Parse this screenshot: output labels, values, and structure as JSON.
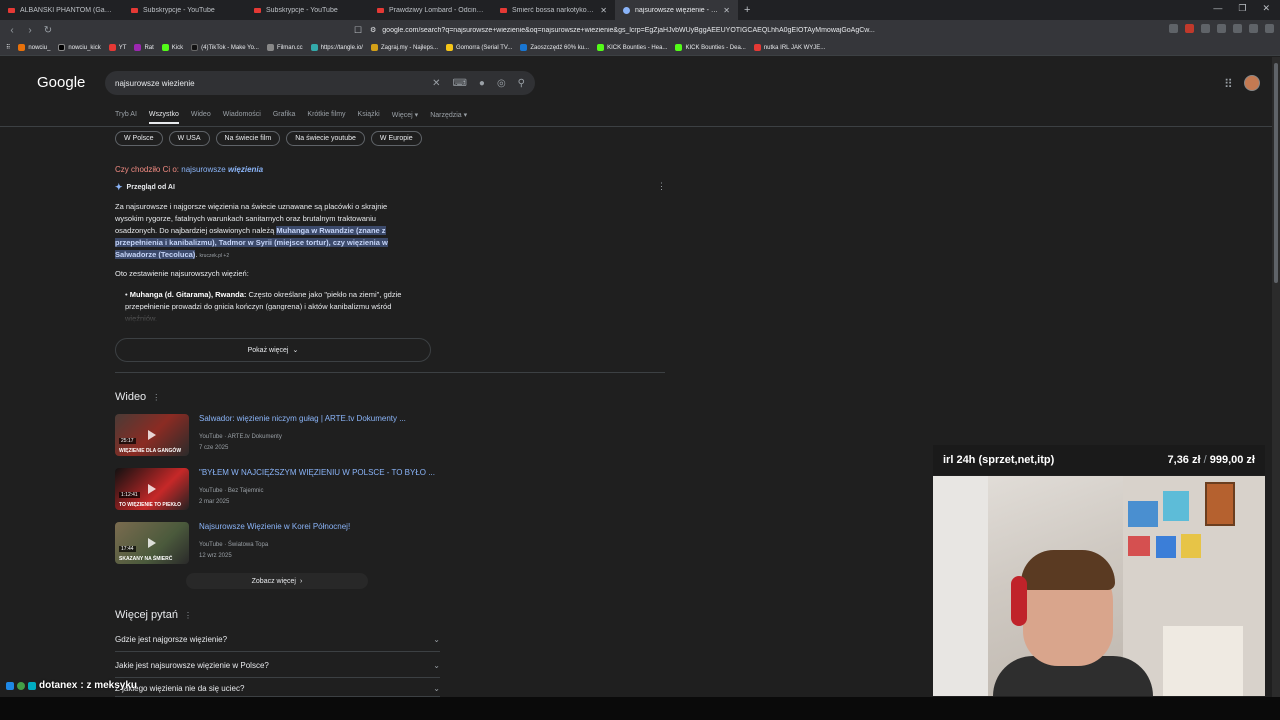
{
  "browser": {
    "tabs": [
      {
        "label": "ALBAŃSKI PHANTOM (Gang albani"
      },
      {
        "label": "Subskrypcje - YouTube"
      },
      {
        "label": "Subskrypcje - YouTube"
      },
      {
        "label": "Prawdziwy Lombard - Odcinek 331"
      },
      {
        "label": "Śmierć bossa narkotykowego i"
      },
      {
        "label": "najsurowsze więzienie - Szukaj"
      }
    ],
    "new_tab": "+",
    "url": "google.com/search?q=najsurowsze+wiezienie&oq=najsurowsze+wiezienie&gs_lcrp=EgZjaHJvbWUyBggAEEUYOTIGCAEQLhhA0gEIOTAyMmowajGoAgCw...",
    "bookmarks": [
      "nowciu_",
      "nowciu_kick",
      "YT",
      "Rat",
      "Kick",
      "(4)TikTok - Make Yo...",
      "Filman.cc",
      "https://tangle.io/",
      "Zagraj.my - Najleps...",
      "Gomorra (Serial TV...",
      "Zaoszczędź 60% ku...",
      "KICK Bounties - Hea...",
      "KICK Bounties - Dea...",
      "nutka IRL JAK WYJE..."
    ]
  },
  "google": {
    "logo": "Google",
    "query": "najsurowsze wiezienie",
    "tabs": [
      "Tryb AI",
      "Wszystko",
      "Wideo",
      "Wiadomości",
      "Grafika",
      "Krótkie filmy",
      "Książki",
      "Więcej ▾",
      "Narzędzia ▾"
    ],
    "chips": [
      "W Polsce",
      "W USA",
      "Na świecie film",
      "Na świecie youtube",
      "W Europie"
    ],
    "did_you_mean": {
      "prefix": "Czy chodziło Ci o:",
      "word": "najsurowsze",
      "emph": "więzienia"
    },
    "ai_overview": {
      "title": "Przegląd od AI",
      "text_a": "Za najsurowsze i najgorsze więzienia na świecie uznawane są placówki o skrajnie wysokim rygorze, fatalnych warunkach sanitarnych oraz brutalnym traktowaniu osadzonych. Do najbardziej osławionych należą",
      "text_hl": "Muhanga w Rwandzie (znane z przepełnienia i kanibalizmu), Tadmor w Syrii (miejsce tortur), czy więzienia w Salwadorze (Tecoluca)",
      "text_end": ".",
      "source": "kruczek.pl +2",
      "sub": "Oto zestawienie najsurowszych więzień:",
      "bullet_bold": "Muhanga (d. Gitarama), Rwanda:",
      "bullet_text": "Często określane jako \"piekło na ziemi\", gdzie przepełnienie prowadzi do gnicia kończyn (gangrena) i aktów kanibalizmu wśród więźniów.",
      "show_more": "Pokaż więcej"
    },
    "videos_title": "Wideo",
    "videos": [
      {
        "title": "Salwador: więzienie niczym gułag | ARTE.tv Dokumenty ...",
        "meta": "YouTube · ARTE.tv Dokumenty",
        "date": "7 cze 2025",
        "duration": "25:17",
        "thumb_text": "WIĘZIENIE DLA GANGÓW"
      },
      {
        "title": "\"BYŁEM W NAJCIĘŻSZYM WIĘZIENIU W POLSCE - TO BYŁO ...",
        "meta": "YouTube · Bez Tajemnic",
        "date": "2 mar 2025",
        "duration": "1:12:41",
        "thumb_text": "TO WIĘZIENIE TO PIEKŁO"
      },
      {
        "title": "Najsurowsze Więzienie w Korei Północnej!",
        "meta": "YouTube · Światowa Topa",
        "date": "12 wrz 2025",
        "duration": "17:44",
        "thumb_text": "SKAZANY NA ŚMIERĆ"
      }
    ],
    "see_more": "Zobacz więcej",
    "paa_title": "Więcej pytań",
    "paa": [
      "Gdzie jest najgorsze więzienie?",
      "Jakie jest najsurowsze więzienie w Polsce?",
      "Z jakiego więzienia nie da się uciec?"
    ]
  },
  "stream": {
    "goal_label": "irl 24h (sprzet,net,itp)",
    "goal_current": "7,36 zł",
    "goal_sep": "/",
    "goal_target": "999,00 zł",
    "goal_progress": 0.007,
    "chat_user": "dotanex",
    "chat_msg": ": z meksyku"
  }
}
